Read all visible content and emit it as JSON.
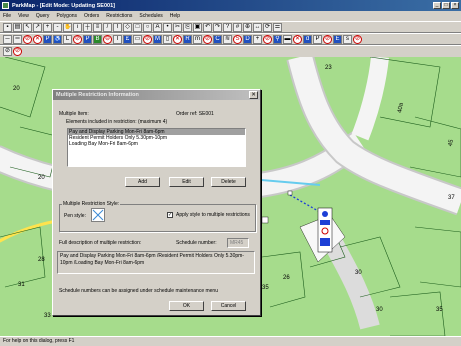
{
  "window": {
    "title": "ParkMap - [Edit Mode: Updating SE001]"
  },
  "menu": [
    "File",
    "View",
    "Query",
    "Polygons",
    "Orders",
    "Restrictions",
    "Schedules",
    "Help"
  ],
  "map": {
    "labels": [
      "20",
      "20",
      "23",
      "40a",
      "45",
      "28",
      "31",
      "30",
      "33",
      "30",
      "35",
      "35",
      "26",
      "37"
    ]
  },
  "dialog": {
    "title": "Multiple Restriction Information",
    "multiple_item_label": "Multiple Item:",
    "order_ref": "Order ref: SE001",
    "elements_label": "Elements included in restriction:  (maximum 4)",
    "elements": [
      "Pay and Display Parking Mon-Fri 8am-6pm",
      "Resident Permit Holders Only 5.30pm-10pm",
      "Loading Bay Mon-Fri 8am-6pm"
    ],
    "add": "Add",
    "edit": "Edit",
    "delete": "Delete",
    "style_group": "Multiple Restriction Style:",
    "pen_style": "Pen style:",
    "apply_style": "Apply style to multiple restrictions",
    "apply_checked": true,
    "full_desc_label": "Full description of multiple restriction:",
    "schedule_label": "Schedule number:",
    "schedule_value": "MR45",
    "full_desc": "Pay and Display Parking Mon-Fri 8am-6pm /Resident Permit Holders Only 5.30pm-10pm /Loading Bay Mon-Fri 8am-6pm",
    "footer_note": "Schedule numbers can be assigned under schedule maintenance menu",
    "ok": "OK",
    "cancel": "Cancel"
  },
  "status": "For help on this dialog, press F1"
}
